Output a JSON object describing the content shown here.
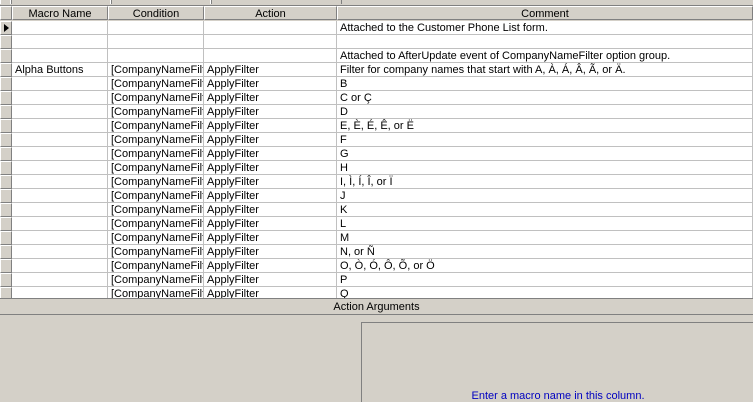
{
  "columns": {
    "macro_name": "Macro Name",
    "condition": "Condition",
    "action": "Action",
    "comment": "Comment"
  },
  "rows": [
    {
      "name": "",
      "condition": "",
      "action": "",
      "comment": "Attached to the Customer Phone List form."
    },
    {
      "name": "",
      "condition": "",
      "action": "",
      "comment": ""
    },
    {
      "name": "",
      "condition": "",
      "action": "",
      "comment": "Attached to AfterUpdate event of CompanyNameFilter option group."
    },
    {
      "name": "Alpha Buttons",
      "condition": "[CompanyNameFilte",
      "action": "ApplyFilter",
      "comment": "Filter for company names that start with A, À, Á, Â, Ã, or Ä."
    },
    {
      "name": "",
      "condition": "[CompanyNameFilte",
      "action": "ApplyFilter",
      "comment": "B"
    },
    {
      "name": "",
      "condition": "[CompanyNameFilte",
      "action": "ApplyFilter",
      "comment": "C or Ç"
    },
    {
      "name": "",
      "condition": "[CompanyNameFilte",
      "action": "ApplyFilter",
      "comment": "D"
    },
    {
      "name": "",
      "condition": "[CompanyNameFilte",
      "action": "ApplyFilter",
      "comment": "E, È, É, Ê, or Ë"
    },
    {
      "name": "",
      "condition": "[CompanyNameFilte",
      "action": "ApplyFilter",
      "comment": "F"
    },
    {
      "name": "",
      "condition": "[CompanyNameFilte",
      "action": "ApplyFilter",
      "comment": "G"
    },
    {
      "name": "",
      "condition": "[CompanyNameFilte",
      "action": "ApplyFilter",
      "comment": "H"
    },
    {
      "name": "",
      "condition": "[CompanyNameFilte",
      "action": "ApplyFilter",
      "comment": "I, Ì, Í, Î, or Ï"
    },
    {
      "name": "",
      "condition": "[CompanyNameFilte",
      "action": "ApplyFilter",
      "comment": "J"
    },
    {
      "name": "",
      "condition": "[CompanyNameFilte",
      "action": "ApplyFilter",
      "comment": "K"
    },
    {
      "name": "",
      "condition": "[CompanyNameFilte",
      "action": "ApplyFilter",
      "comment": "L"
    },
    {
      "name": "",
      "condition": "[CompanyNameFilte",
      "action": "ApplyFilter",
      "comment": "M"
    },
    {
      "name": "",
      "condition": "[CompanyNameFilte",
      "action": "ApplyFilter",
      "comment": "N, or Ñ"
    },
    {
      "name": "",
      "condition": "[CompanyNameFilte",
      "action": "ApplyFilter",
      "comment": "O, Ò, Ó, Ô, Õ, or Ö"
    },
    {
      "name": "",
      "condition": "[CompanyNameFilte",
      "action": "ApplyFilter",
      "comment": "P"
    },
    {
      "name": "",
      "condition": "[CompanyNameFilte",
      "action": "ApplyFilter",
      "comment": "Q"
    }
  ],
  "lower_pane": {
    "title": "Action Arguments",
    "help_text": "Enter a macro name in this column."
  },
  "colors": {
    "help_text": "#0000c0",
    "chrome": "#d4d0c8"
  },
  "icons": {
    "current_row": "current-row-arrow-icon"
  }
}
